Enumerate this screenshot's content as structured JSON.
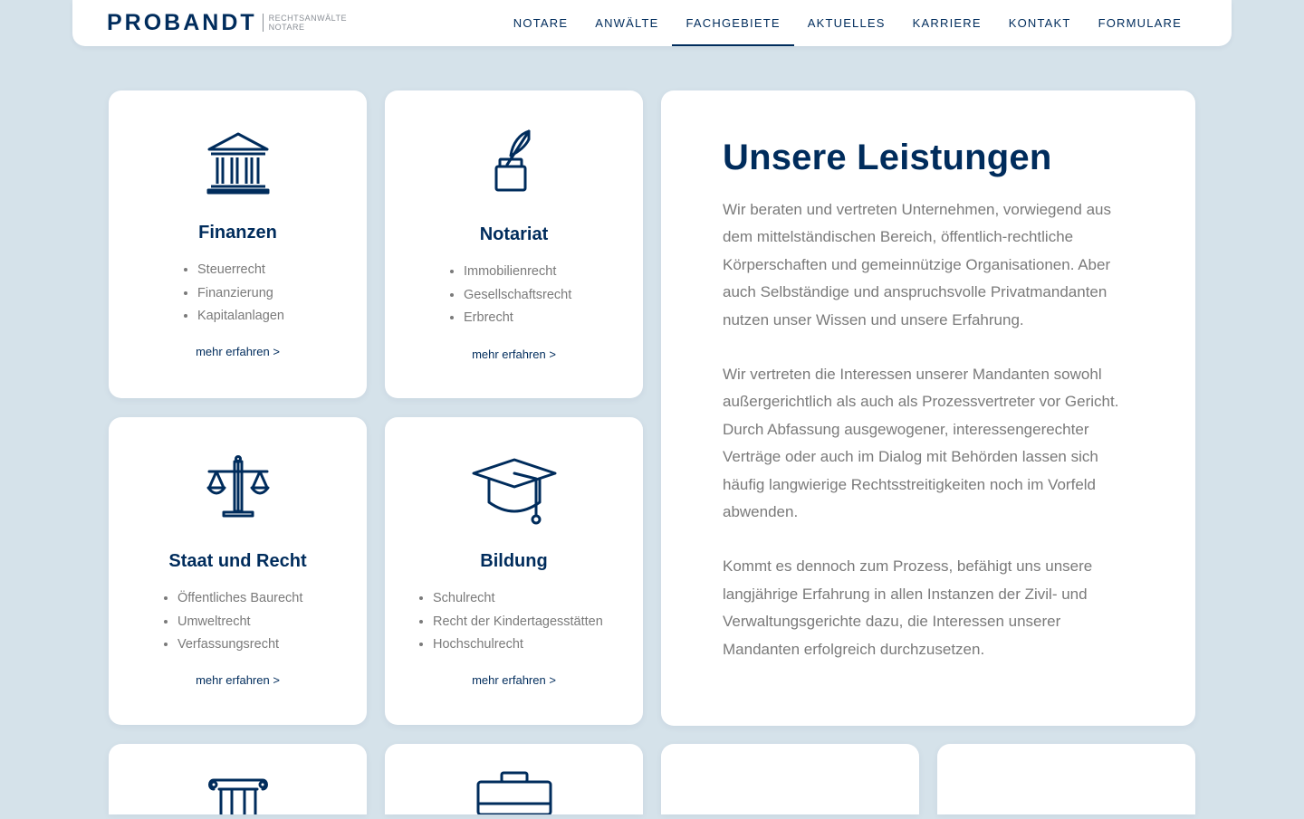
{
  "brand": {
    "name": "PROBANDT",
    "line1": "RECHTSANWÄLTE",
    "line2": "NOTARE"
  },
  "nav": [
    {
      "label": "NOTARE"
    },
    {
      "label": "ANWÄLTE"
    },
    {
      "label": "FACHGEBIETE",
      "active": true
    },
    {
      "label": "AKTUELLES"
    },
    {
      "label": "KARRIERE"
    },
    {
      "label": "KONTAKT"
    },
    {
      "label": "FORMULARE"
    }
  ],
  "services": [
    {
      "title": "Finanzen",
      "icon": "bank-icon",
      "items": [
        "Steuerrecht",
        "Finanzierung",
        "Kapitalanlagen"
      ],
      "link": "mehr erfahren >"
    },
    {
      "title": "Notariat",
      "icon": "quill-inkpot-icon",
      "items": [
        "Immobilienrecht",
        "Gesellschaftsrecht",
        "Erbrecht"
      ],
      "link": "mehr erfahren >"
    },
    {
      "title": "Staat und Recht",
      "icon": "scales-icon",
      "items": [
        "Öffentliches Baurecht",
        "Umweltrecht",
        "Verfassungsrecht"
      ],
      "link": "mehr erfahren >"
    },
    {
      "title": "Bildung",
      "icon": "graduation-cap-icon",
      "items": [
        "Schulrecht",
        "Recht der Kindertagesstätten",
        "Hochschulrecht"
      ],
      "link": "mehr erfahren >"
    }
  ],
  "info": {
    "title": "Unsere Leistungen",
    "paragraphs": [
      "Wir beraten und vertreten Unternehmen, vorwiegend aus dem mittelständischen Bereich, öffentlich-rechtliche Körperschaften und gemeinnützige Organisationen. Aber auch Selbständige und anspruchsvolle Privatmandanten nutzen unser Wissen und unsere Erfahrung.",
      "Wir vertreten die Interessen unserer Mandanten sowohl außergerichtlich als auch als Prozessvertreter vor Gericht. Durch Abfassung ausgewogener, interessengerechter Verträge oder auch im Dialog mit Behörden lassen sich häufig langwierige Rechtsstreitigkeiten noch im Vorfeld abwenden.",
      "Kommt es dennoch zum Prozess, befähigt uns unsere langjährige Erfahrung in allen Instanzen der Zivil- und Verwaltungsgerichte dazu, die Interessen unserer Mandanten erfolgreich durchzusetzen."
    ]
  },
  "partial_cards": [
    {
      "icon": "column-icon"
    },
    {
      "icon": "briefcase-icon"
    }
  ],
  "colors": {
    "primary": "#002c5c",
    "background": "#d5e2ea",
    "card": "#ffffff",
    "text_muted": "#7a7a7a"
  }
}
